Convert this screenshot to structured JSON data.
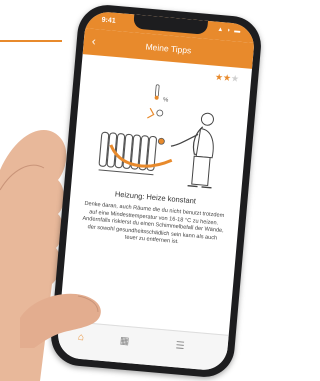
{
  "status_bar": {
    "time": "9:41",
    "icons": "▲ ◗ ▬"
  },
  "header": {
    "back_icon": "chevron-left-icon",
    "title": "Meine Tipps"
  },
  "rating": {
    "stars_filled": 2,
    "stars_total": 3
  },
  "tip": {
    "title": "Heizung: Heize konstant",
    "body": "Denke daran, auch Räume die du nicht benutzt trotzdem auf eine Mindesttemperatur von 16-18 °C zu heizen. Andernfalls riskierst du einen Schimmelbefall der Wände, der sowohl gesundheitsschädlich sein kann als auch teuer zu entfernen ist."
  },
  "tabs": [
    {
      "icon": "home-icon"
    },
    {
      "icon": "building-icon"
    },
    {
      "icon": "list-icon"
    }
  ],
  "colors": {
    "accent": "#e88a2c"
  }
}
